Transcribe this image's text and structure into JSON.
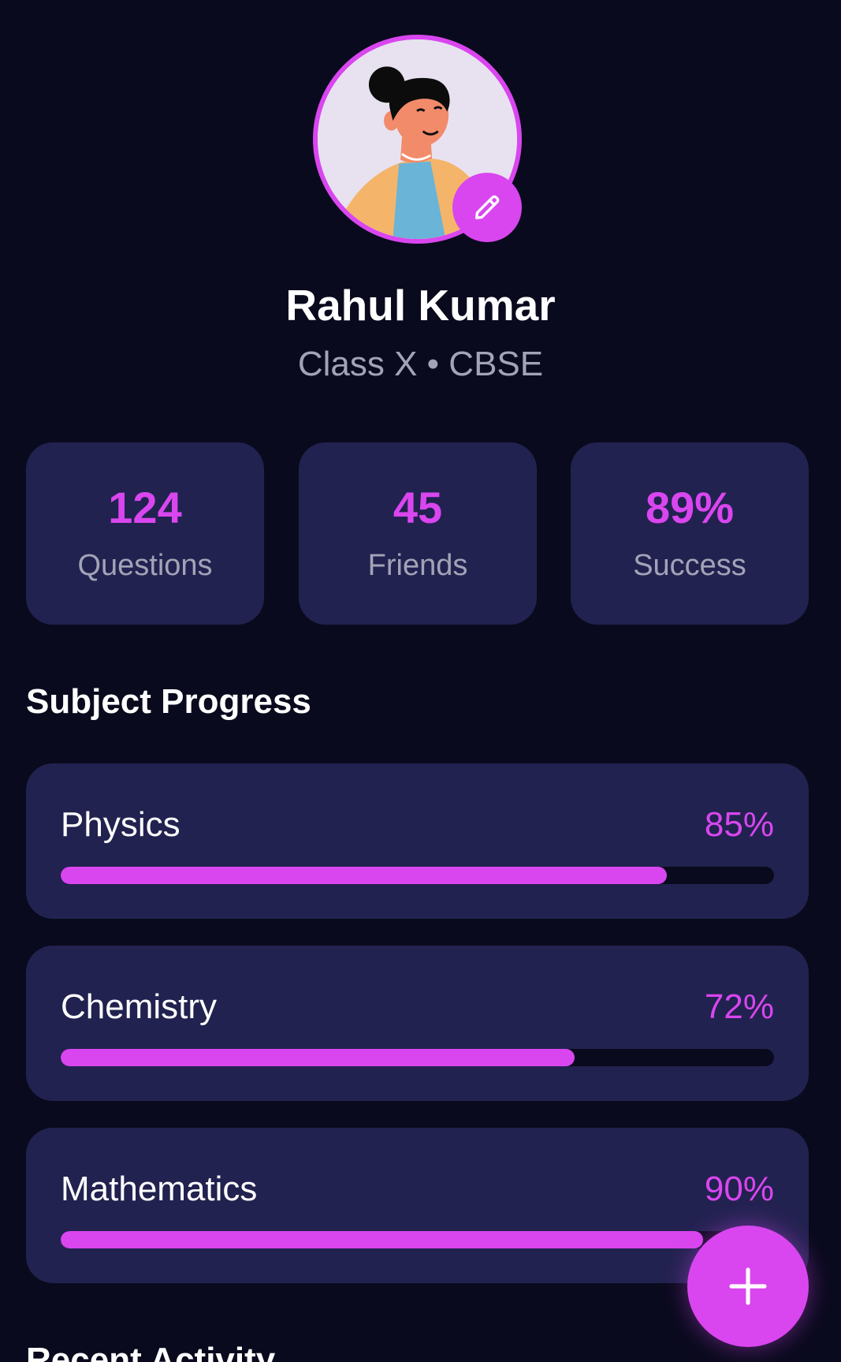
{
  "profile": {
    "name": "Rahul Kumar",
    "subtitle": "Class X • CBSE"
  },
  "stats": [
    {
      "value": "124",
      "label": "Questions"
    },
    {
      "value": "45",
      "label": "Friends"
    },
    {
      "value": "89%",
      "label": "Success"
    }
  ],
  "subject_progress": {
    "title": "Subject Progress",
    "items": [
      {
        "name": "Physics",
        "percent_label": "85%",
        "fraction": 0.85
      },
      {
        "name": "Chemistry",
        "percent_label": "72%",
        "fraction": 0.72
      },
      {
        "name": "Mathematics",
        "percent_label": "90%",
        "fraction": 0.9
      }
    ]
  },
  "recent_activity": {
    "title": "Recent Activity"
  },
  "icons": {
    "edit": "pencil-icon",
    "fab": "plus-icon"
  },
  "colors": {
    "background": "#0a0a1e",
    "card": "#222250",
    "accent": "#d946ef",
    "muted_text": "#a3a3b8"
  }
}
